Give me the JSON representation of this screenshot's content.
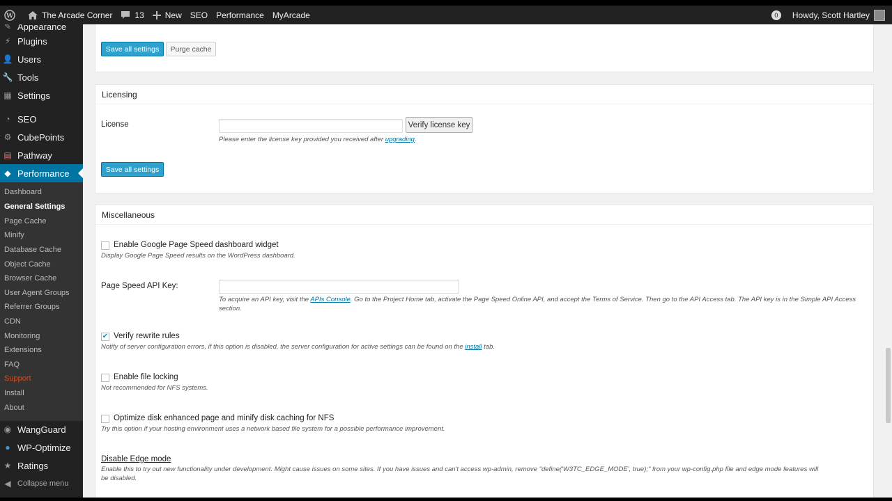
{
  "adminbar": {
    "site_name": "The Arcade Corner",
    "comments_count": "13",
    "new_label": "New",
    "seo_label": "SEO",
    "performance_label": "Performance",
    "myarcade_label": "MyArcade",
    "notification_count": "0",
    "howdy": "Howdy, Scott Hartley"
  },
  "sidebar": {
    "items": [
      {
        "label": "Appearance",
        "icon": "paintbrush-icon"
      },
      {
        "label": "Plugins",
        "icon": "plugin-icon"
      },
      {
        "label": "Users",
        "icon": "users-icon"
      },
      {
        "label": "Tools",
        "icon": "wrench-icon"
      },
      {
        "label": "Settings",
        "icon": "settings-icon"
      },
      {
        "label": "SEO",
        "icon": "seo-icon"
      },
      {
        "label": "CubePoints",
        "icon": "gear-icon"
      },
      {
        "label": "Pathway",
        "icon": "pathway-icon"
      },
      {
        "label": "Performance",
        "icon": "performance-icon"
      },
      {
        "label": "WangGuard",
        "icon": "wangguard-icon"
      },
      {
        "label": "WP-Optimize",
        "icon": "wp-optimize-icon"
      },
      {
        "label": "Ratings",
        "icon": "star-icon"
      }
    ],
    "submenu": [
      "Dashboard",
      "General Settings",
      "Page Cache",
      "Minify",
      "Database Cache",
      "Object Cache",
      "Browser Cache",
      "User Agent Groups",
      "Referrer Groups",
      "CDN",
      "Monitoring",
      "Extensions",
      "FAQ",
      "Support",
      "Install",
      "About"
    ],
    "collapse_label": "Collapse menu"
  },
  "top_box": {
    "save_label": "Save all settings",
    "purge_label": "Purge cache"
  },
  "licensing": {
    "title": "Licensing",
    "license_label": "License",
    "license_value": "",
    "verify_label": "Verify license key",
    "desc_text": "Please enter the license key provided you received after ",
    "desc_link": "upgrading",
    "desc_end": ".",
    "save_label": "Save all settings"
  },
  "misc": {
    "title": "Miscellaneous",
    "pagespeed_widget_label": "Enable Google Page Speed dashboard widget",
    "pagespeed_widget_desc": "Display Google Page Speed results on the WordPress dashboard.",
    "pagespeed_widget_checked": false,
    "api_key_label": "Page Speed API Key:",
    "api_key_value": "",
    "api_desc_1": "To acquire an API key, visit the ",
    "api_desc_link": "APIs Console",
    "api_desc_2": ". Go to the Project Home tab, activate the Page Speed Online API, and accept the Terms of Service. Then go to the API Access tab. The API key is in the Simple API Access",
    "api_desc_3": "section.",
    "rewrite_label": "Verify rewrite rules",
    "rewrite_checked": true,
    "rewrite_desc_1": "Notify of server configuration errors, if this option is disabled, the server configuration for active settings can be found on the ",
    "rewrite_desc_link": "install",
    "rewrite_desc_2": " tab.",
    "filelock_label": "Enable file locking",
    "filelock_checked": false,
    "filelock_desc": "Not recommended for NFS systems.",
    "nfs_label": "Optimize disk enhanced page and minify disk caching for NFS",
    "nfs_checked": false,
    "nfs_desc": "Try this option if your hosting environment uses a network based file system for a possible performance improvement.",
    "edge_link": "Disable Edge mode",
    "edge_desc_1": "Enable this to try out new functionality under development. Might cause issues on some sites. If you have issues and can't access wp-admin, remove \"define('W3TC_EDGE_MODE', true);\" from your wp-config.php file and edge mode features will",
    "edge_desc_2": "be disabled."
  }
}
